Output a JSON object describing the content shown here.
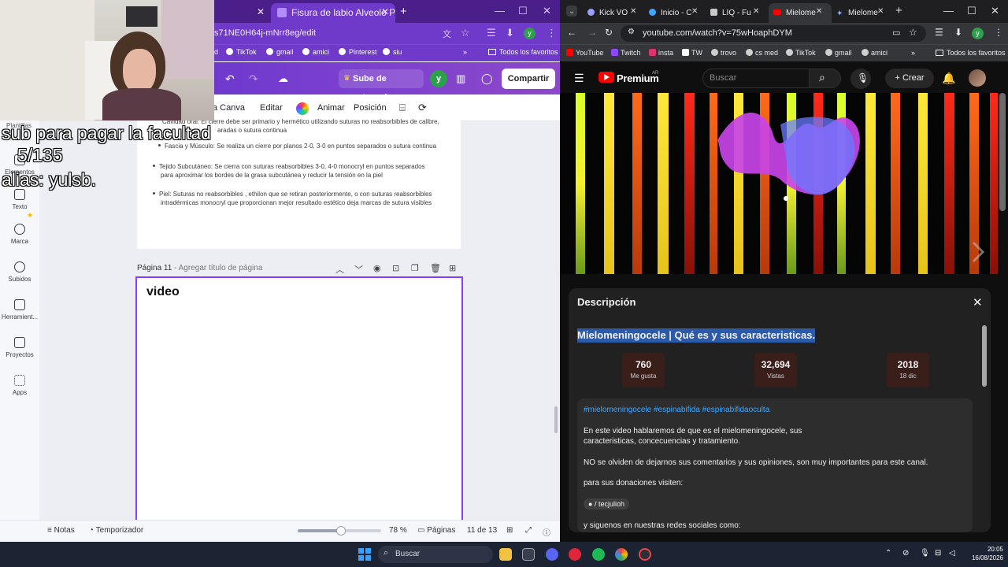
{
  "left_browser": {
    "tabs": [
      {
        "label": ""
      },
      {
        "label": "Fisura de labio Alveolo Palatin"
      }
    ],
    "url": "s71NE0H64j-mNrr8eg/edit",
    "bookmarks": [
      "d",
      "TikTok",
      "gmail",
      "amici",
      "Pinterest",
      "siu"
    ],
    "bookmarks_folder": "Todos los favoritos",
    "profile_letter": "y"
  },
  "canva": {
    "upgrade_label": "Sube de categoría",
    "avatar_letter": "y",
    "share_label": "Compartir",
    "toolbar": {
      "canva_label": "a Canva",
      "edit_label": "Editar",
      "animate_label": "Animar",
      "position_label": "Posición"
    },
    "sidebar": [
      {
        "label": "Elementos"
      },
      {
        "label": "Texto"
      },
      {
        "label": "Marca"
      },
      {
        "label": "Subidos"
      },
      {
        "label": "Herramient..."
      },
      {
        "label": "Proyectos"
      },
      {
        "label": "Apps"
      }
    ],
    "doc_lines": {
      "top_line": "Cavidad oral: El cierre debe ser primario y hermético utilizando suturas no reabsorbibles de calibre,",
      "top_line2": "aradas o sutura continua",
      "fascia": "Fascia y Músculo: Se realiza un cierre por planos 2-0, 3-0 en puntos separados o sutura continua",
      "subcut_1": "Tejido Subcutáneo:  Se cierra con suturas reabsorbibles 3-0, 4-0 monocryl en puntos separados",
      "subcut_2": "para aproximar los bordes de la grasa subcutánea y reducir la tensión en la piel",
      "piel_1": "Piel: Suturas no reabsorbibles , ethilon que se retiran posteriormente, o con suturas reabsorbibles",
      "piel_2": "intradérmicas monocryl que proporcionan mejor resultado estético  deja marcas de sutura visibles"
    },
    "page_label": "Página 11",
    "page_title_placeholder": "- Agregar título de página",
    "page_content": "video",
    "footer": {
      "notes": "Notas",
      "timer": "Temporizador",
      "zoom": "78 %",
      "zoom_value": 0.52,
      "pages_label": "Páginas",
      "page_count": "11 de 13"
    }
  },
  "overlay": {
    "line1": "sub para pagar la facultad",
    "line2": "5/135",
    "line3": "alias: yulsb.",
    "faded_label": "Plantillas"
  },
  "right_browser": {
    "tabs": [
      {
        "label": "Kick VO"
      },
      {
        "label": "Inicio - C"
      },
      {
        "label": "LIQ - Fu"
      },
      {
        "label": "Mielome"
      },
      {
        "label": "Mielome"
      }
    ],
    "url": "youtube.com/watch?v=75wHoaphDYM",
    "bookmarks": [
      "YouTube",
      "Twitch",
      "insta",
      "TW",
      "trovo",
      "cs med",
      "TikTok",
      "gmail",
      "amici"
    ],
    "bookmarks_folder": "Todos los favoritos",
    "profile_letter": "y"
  },
  "youtube": {
    "brand": "Premium",
    "region": "AR",
    "search_placeholder": "Buscar",
    "create_label": "Crear",
    "description_heading": "Descripción",
    "video_title": "Mielomeningocele | Qué es y sus caracteristicas.",
    "stats": [
      {
        "value": "760",
        "label": "Me gusta"
      },
      {
        "value": "32,694",
        "label": "Vistas"
      },
      {
        "value": "2018",
        "label": "18 dic"
      }
    ],
    "hashtags": "#mielomeningocele #espinabifida #espinabifidaoculta",
    "desc_line1": "En este video hablaremos de que es el mielomeningocele, sus",
    "desc_line2": "caracteristicas, concecuencias y tratamiento.",
    "desc_line3": "NO se olviden de dejarnos sus comentarios y sus opiniones, son muy importantes para este canal.",
    "desc_line4": "para sus donaciones  visiten:",
    "channel_pill": "/ tecjulioh",
    "desc_line5": "y siguenos en nuestras redes sociales como:"
  },
  "taskbar": {
    "search_placeholder": "Buscar",
    "time": "20:05",
    "date": "16/08/2026"
  },
  "colors": {
    "canva_purple": "#6f39c9",
    "page_border": "#8b3dff",
    "yt_red": "#ff0000",
    "link_blue": "#3ea6ff",
    "selection": "#2c5aa8"
  }
}
